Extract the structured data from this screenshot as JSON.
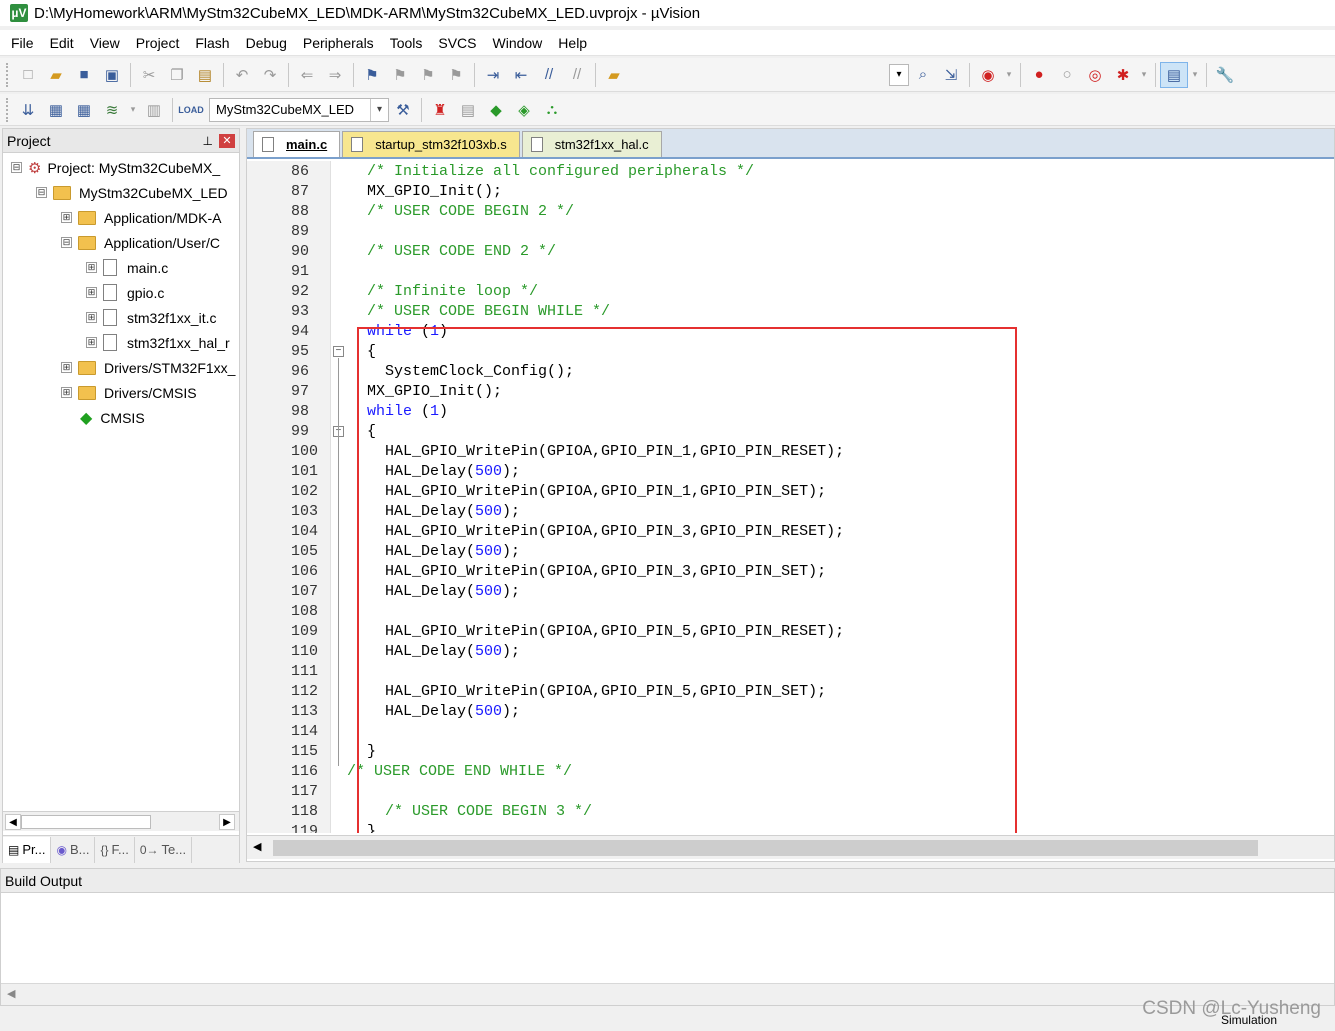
{
  "window": {
    "app_icon": "µV",
    "title": "D:\\MyHomework\\ARM\\MyStm32CubeMX_LED\\MDK-ARM\\MyStm32CubeMX_LED.uvprojx - µVision"
  },
  "menu": [
    "File",
    "Edit",
    "View",
    "Project",
    "Flash",
    "Debug",
    "Peripherals",
    "Tools",
    "SVCS",
    "Window",
    "Help"
  ],
  "toolbar": {
    "target_name": "MyStm32CubeMX_LED"
  },
  "project_panel": {
    "title": "Project",
    "tree": [
      {
        "label": "Project: MyStm32CubeMX_",
        "type": "project",
        "expander": "⊟"
      },
      {
        "label": "MyStm32CubeMX_LED",
        "type": "target",
        "expander": "⊟"
      },
      {
        "label": "Application/MDK-A",
        "type": "folder",
        "expander": "⊞"
      },
      {
        "label": "Application/User/C",
        "type": "folder",
        "expander": "⊟"
      },
      {
        "label": "main.c",
        "type": "file",
        "expander": "⊞"
      },
      {
        "label": "gpio.c",
        "type": "file",
        "expander": "⊞"
      },
      {
        "label": "stm32f1xx_it.c",
        "type": "file",
        "expander": "⊞"
      },
      {
        "label": "stm32f1xx_hal_r",
        "type": "file",
        "expander": "⊞"
      },
      {
        "label": "Drivers/STM32F1xx_",
        "type": "folder",
        "expander": "⊞"
      },
      {
        "label": "Drivers/CMSIS",
        "type": "folder",
        "expander": "⊞"
      },
      {
        "label": "CMSIS",
        "type": "cmsis",
        "expander": ""
      }
    ],
    "tabs": [
      {
        "label": "Pr...",
        "icon": "project-icon"
      },
      {
        "label": "B...",
        "icon": "books-icon"
      },
      {
        "label": "F...",
        "icon": "functions-icon"
      },
      {
        "label": "Te...",
        "icon": "templates-icon"
      }
    ]
  },
  "editor": {
    "tabs": [
      {
        "label": "main.c",
        "active": true
      },
      {
        "label": "startup_stm32f103xb.s",
        "active": false
      },
      {
        "label": "stm32f1xx_hal.c",
        "active": false
      }
    ],
    "lines": [
      {
        "n": "86",
        "code": "/* Initialize all configured peripherals */",
        "kind": "comment"
      },
      {
        "n": "87",
        "code": "MX_GPIO_Init();",
        "kind": "plain"
      },
      {
        "n": "88",
        "code": "/* USER CODE BEGIN 2 */",
        "kind": "comment"
      },
      {
        "n": "89",
        "code": "",
        "kind": "plain"
      },
      {
        "n": "90",
        "code": "/* USER CODE END 2 */",
        "kind": "comment"
      },
      {
        "n": "91",
        "code": "",
        "kind": "plain"
      },
      {
        "n": "92",
        "code": "/* Infinite loop */",
        "kind": "comment"
      },
      {
        "n": "93",
        "code": "/* USER CODE BEGIN WHILE */",
        "kind": "comment"
      },
      {
        "n": "94",
        "code": "while (1)",
        "kind": "while"
      },
      {
        "n": "95",
        "code": "{",
        "kind": "plain",
        "fold": "⊟"
      },
      {
        "n": "96",
        "code": "  SystemClock_Config();",
        "kind": "plain"
      },
      {
        "n": "97",
        "code": "MX_GPIO_Init();",
        "kind": "plain"
      },
      {
        "n": "98",
        "code": "while (1)",
        "kind": "while"
      },
      {
        "n": "99",
        "code": "{",
        "kind": "plain",
        "fold": "⊟"
      },
      {
        "n": "100",
        "code": "  HAL_GPIO_WritePin(GPIOA,GPIO_PIN_1,GPIO_PIN_RESET);",
        "kind": "plain"
      },
      {
        "n": "101",
        "code": "  HAL_Delay(500);",
        "kind": "delay"
      },
      {
        "n": "102",
        "code": "  HAL_GPIO_WritePin(GPIOA,GPIO_PIN_1,GPIO_PIN_SET);",
        "kind": "plain"
      },
      {
        "n": "103",
        "code": "  HAL_Delay(500);",
        "kind": "delay"
      },
      {
        "n": "104",
        "code": "  HAL_GPIO_WritePin(GPIOA,GPIO_PIN_3,GPIO_PIN_RESET);",
        "kind": "plain"
      },
      {
        "n": "105",
        "code": "  HAL_Delay(500);",
        "kind": "delay"
      },
      {
        "n": "106",
        "code": "  HAL_GPIO_WritePin(GPIOA,GPIO_PIN_3,GPIO_PIN_SET);",
        "kind": "plain"
      },
      {
        "n": "107",
        "code": "  HAL_Delay(500);",
        "kind": "delay"
      },
      {
        "n": "108",
        "code": "",
        "kind": "plain"
      },
      {
        "n": "109",
        "code": "  HAL_GPIO_WritePin(GPIOA,GPIO_PIN_5,GPIO_PIN_RESET);",
        "kind": "plain"
      },
      {
        "n": "110",
        "code": "  HAL_Delay(500);",
        "kind": "delay"
      },
      {
        "n": "111",
        "code": "",
        "kind": "plain"
      },
      {
        "n": "112",
        "code": "  HAL_GPIO_WritePin(GPIOA,GPIO_PIN_5,GPIO_PIN_SET);",
        "kind": "plain"
      },
      {
        "n": "113",
        "code": "  HAL_Delay(500);",
        "kind": "delay"
      },
      {
        "n": "114",
        "code": "",
        "kind": "plain"
      },
      {
        "n": "115",
        "code": "}",
        "kind": "plain"
      },
      {
        "n": "116",
        "code": "/* USER CODE END WHILE */",
        "kind": "comment-shift"
      },
      {
        "n": "117",
        "code": "",
        "kind": "plain"
      },
      {
        "n": "118",
        "code": "  /* USER CODE BEGIN 3 */",
        "kind": "comment"
      },
      {
        "n": "119",
        "code": "}",
        "kind": "plain"
      }
    ]
  },
  "build_output": {
    "title": "Build Output"
  },
  "status": {
    "mode": "Simulation"
  },
  "watermark": "CSDN @Lc-Yusheng",
  "colors": {
    "comment": "#2a9a2a",
    "keyword": "#1a1aff",
    "highlight_box": "#e53030"
  }
}
